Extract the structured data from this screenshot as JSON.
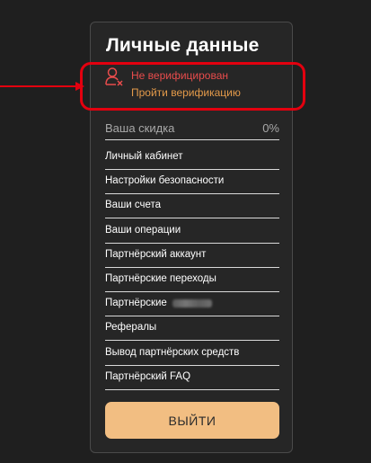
{
  "panel": {
    "title": "Личные данные",
    "verification": {
      "status": "Не верифицирован",
      "link": "Пройти верификацию"
    },
    "discount": {
      "label": "Ваша скидка",
      "value": "0%"
    },
    "menu": [
      {
        "label": "Личный кабинет"
      },
      {
        "label": "Настройки безопасности"
      },
      {
        "label": "Ваши счета"
      },
      {
        "label": "Ваши операции"
      },
      {
        "label": "Партнёрский аккаунт"
      },
      {
        "label": "Партнёрские переходы"
      },
      {
        "label": "Партнёрские"
      },
      {
        "label": "Рефералы"
      },
      {
        "label": "Вывод партнёрских средств"
      },
      {
        "label": "Партнёрский FAQ"
      }
    ],
    "logout_label": "ВЫЙТИ"
  },
  "colors": {
    "background": "#1f1f1f",
    "panel": "#262626",
    "highlight_border": "#e3000f",
    "status_text": "#e84c4c",
    "link_text": "#e39a4a",
    "logout_button": "#f2be82"
  },
  "icons": {
    "user_status": "user-x-icon",
    "annotation": "arrow-right-icon"
  }
}
